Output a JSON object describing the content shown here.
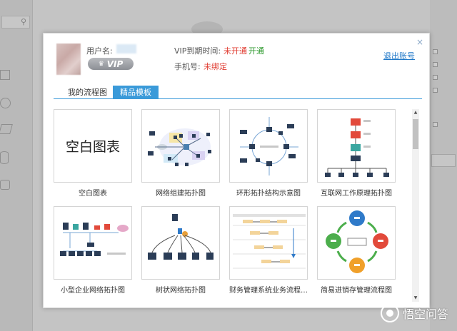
{
  "modal": {
    "close_glyph": "×",
    "user": {
      "username_label": "用户名:",
      "vip_label": "VIP",
      "vip_expiry_label": "VIP到期时间:",
      "vip_status": "未开通",
      "vip_open_link": "开通",
      "phone_label": "手机号:",
      "phone_status": "未绑定",
      "logout": "退出账号"
    },
    "tabs": [
      {
        "label": "我的流程图",
        "active": false
      },
      {
        "label": "精品模板",
        "active": true
      }
    ],
    "templates": [
      {
        "title": "空白图表",
        "thumb_text": "空白图表",
        "icon": "blank-chart"
      },
      {
        "title": "网络组建拓扑图",
        "icon": "network-topology"
      },
      {
        "title": "环形拓扑结构示意图",
        "icon": "ring-topology"
      },
      {
        "title": "互联网工作原理拓扑图",
        "icon": "internet-topology"
      },
      {
        "title": "小型企业网络拓扑图",
        "icon": "small-business-network"
      },
      {
        "title": "树状网络拓扑图",
        "icon": "tree-network"
      },
      {
        "title": "财务管理系统业务流程…",
        "icon": "finance-flow"
      },
      {
        "title": "简易进销存管理流程图",
        "icon": "inventory-flow"
      }
    ]
  },
  "watermark": {
    "text": "悟空问答"
  },
  "colors": {
    "accent": "#3a9ad9",
    "link": "#1f78c8",
    "warning_red": "#e03c31",
    "success_green": "#2f9a2f"
  }
}
